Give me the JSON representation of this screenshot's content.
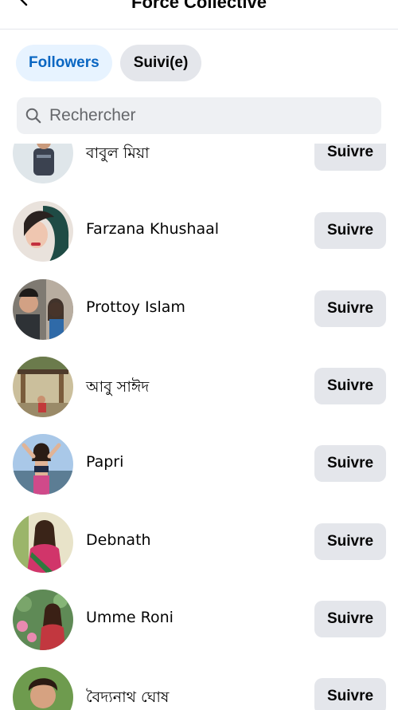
{
  "header": {
    "title": "Force Collective"
  },
  "tabs": [
    {
      "label": "Followers"
    },
    {
      "label": "Suivi(e)"
    }
  ],
  "search": {
    "placeholder": "Rechercher"
  },
  "people": [
    {
      "name": "বাবুল মিয়া",
      "button": "Suivre"
    },
    {
      "name": "Farzana Khushaal",
      "button": "Suivre"
    },
    {
      "name": "Prottoy Islam",
      "button": "Suivre"
    },
    {
      "name": "আবু সাঈদ",
      "button": "Suivre"
    },
    {
      "name": "Papri",
      "button": "Suivre"
    },
    {
      "name": "Debnath",
      "button": "Suivre"
    },
    {
      "name": "Umme Roni",
      "button": "Suivre"
    },
    {
      "name": "বৈদ্যনাথ ঘোষ",
      "button": "Suivre"
    }
  ]
}
